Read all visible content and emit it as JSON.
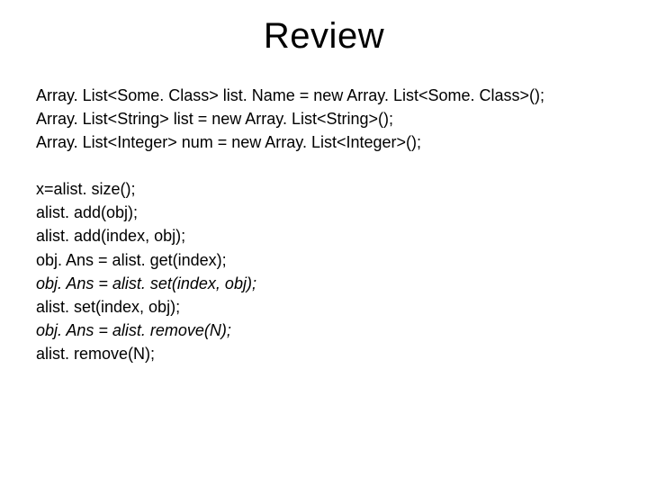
{
  "title": "Review",
  "declarations": [
    "Array. List<Some. Class> list. Name = new Array. List<Some. Class>();",
    "Array. List<String> list = new Array. List<String>();",
    "Array. List<Integer> num = new Array. List<Integer>();"
  ],
  "operations": [
    {
      "text": "x=alist. size();",
      "italic": false
    },
    {
      "text": "alist. add(obj);",
      "italic": false
    },
    {
      "text": "alist. add(index, obj);",
      "italic": false
    },
    {
      "text": "obj. Ans = alist. get(index);",
      "italic": false
    },
    {
      "text": "obj. Ans = alist. set(index, obj);",
      "italic": true
    },
    {
      "text": "alist. set(index, obj);",
      "italic": false
    },
    {
      "text": "obj. Ans = alist. remove(N);",
      "italic": true
    },
    {
      "text": "alist. remove(N);",
      "italic": false
    }
  ]
}
